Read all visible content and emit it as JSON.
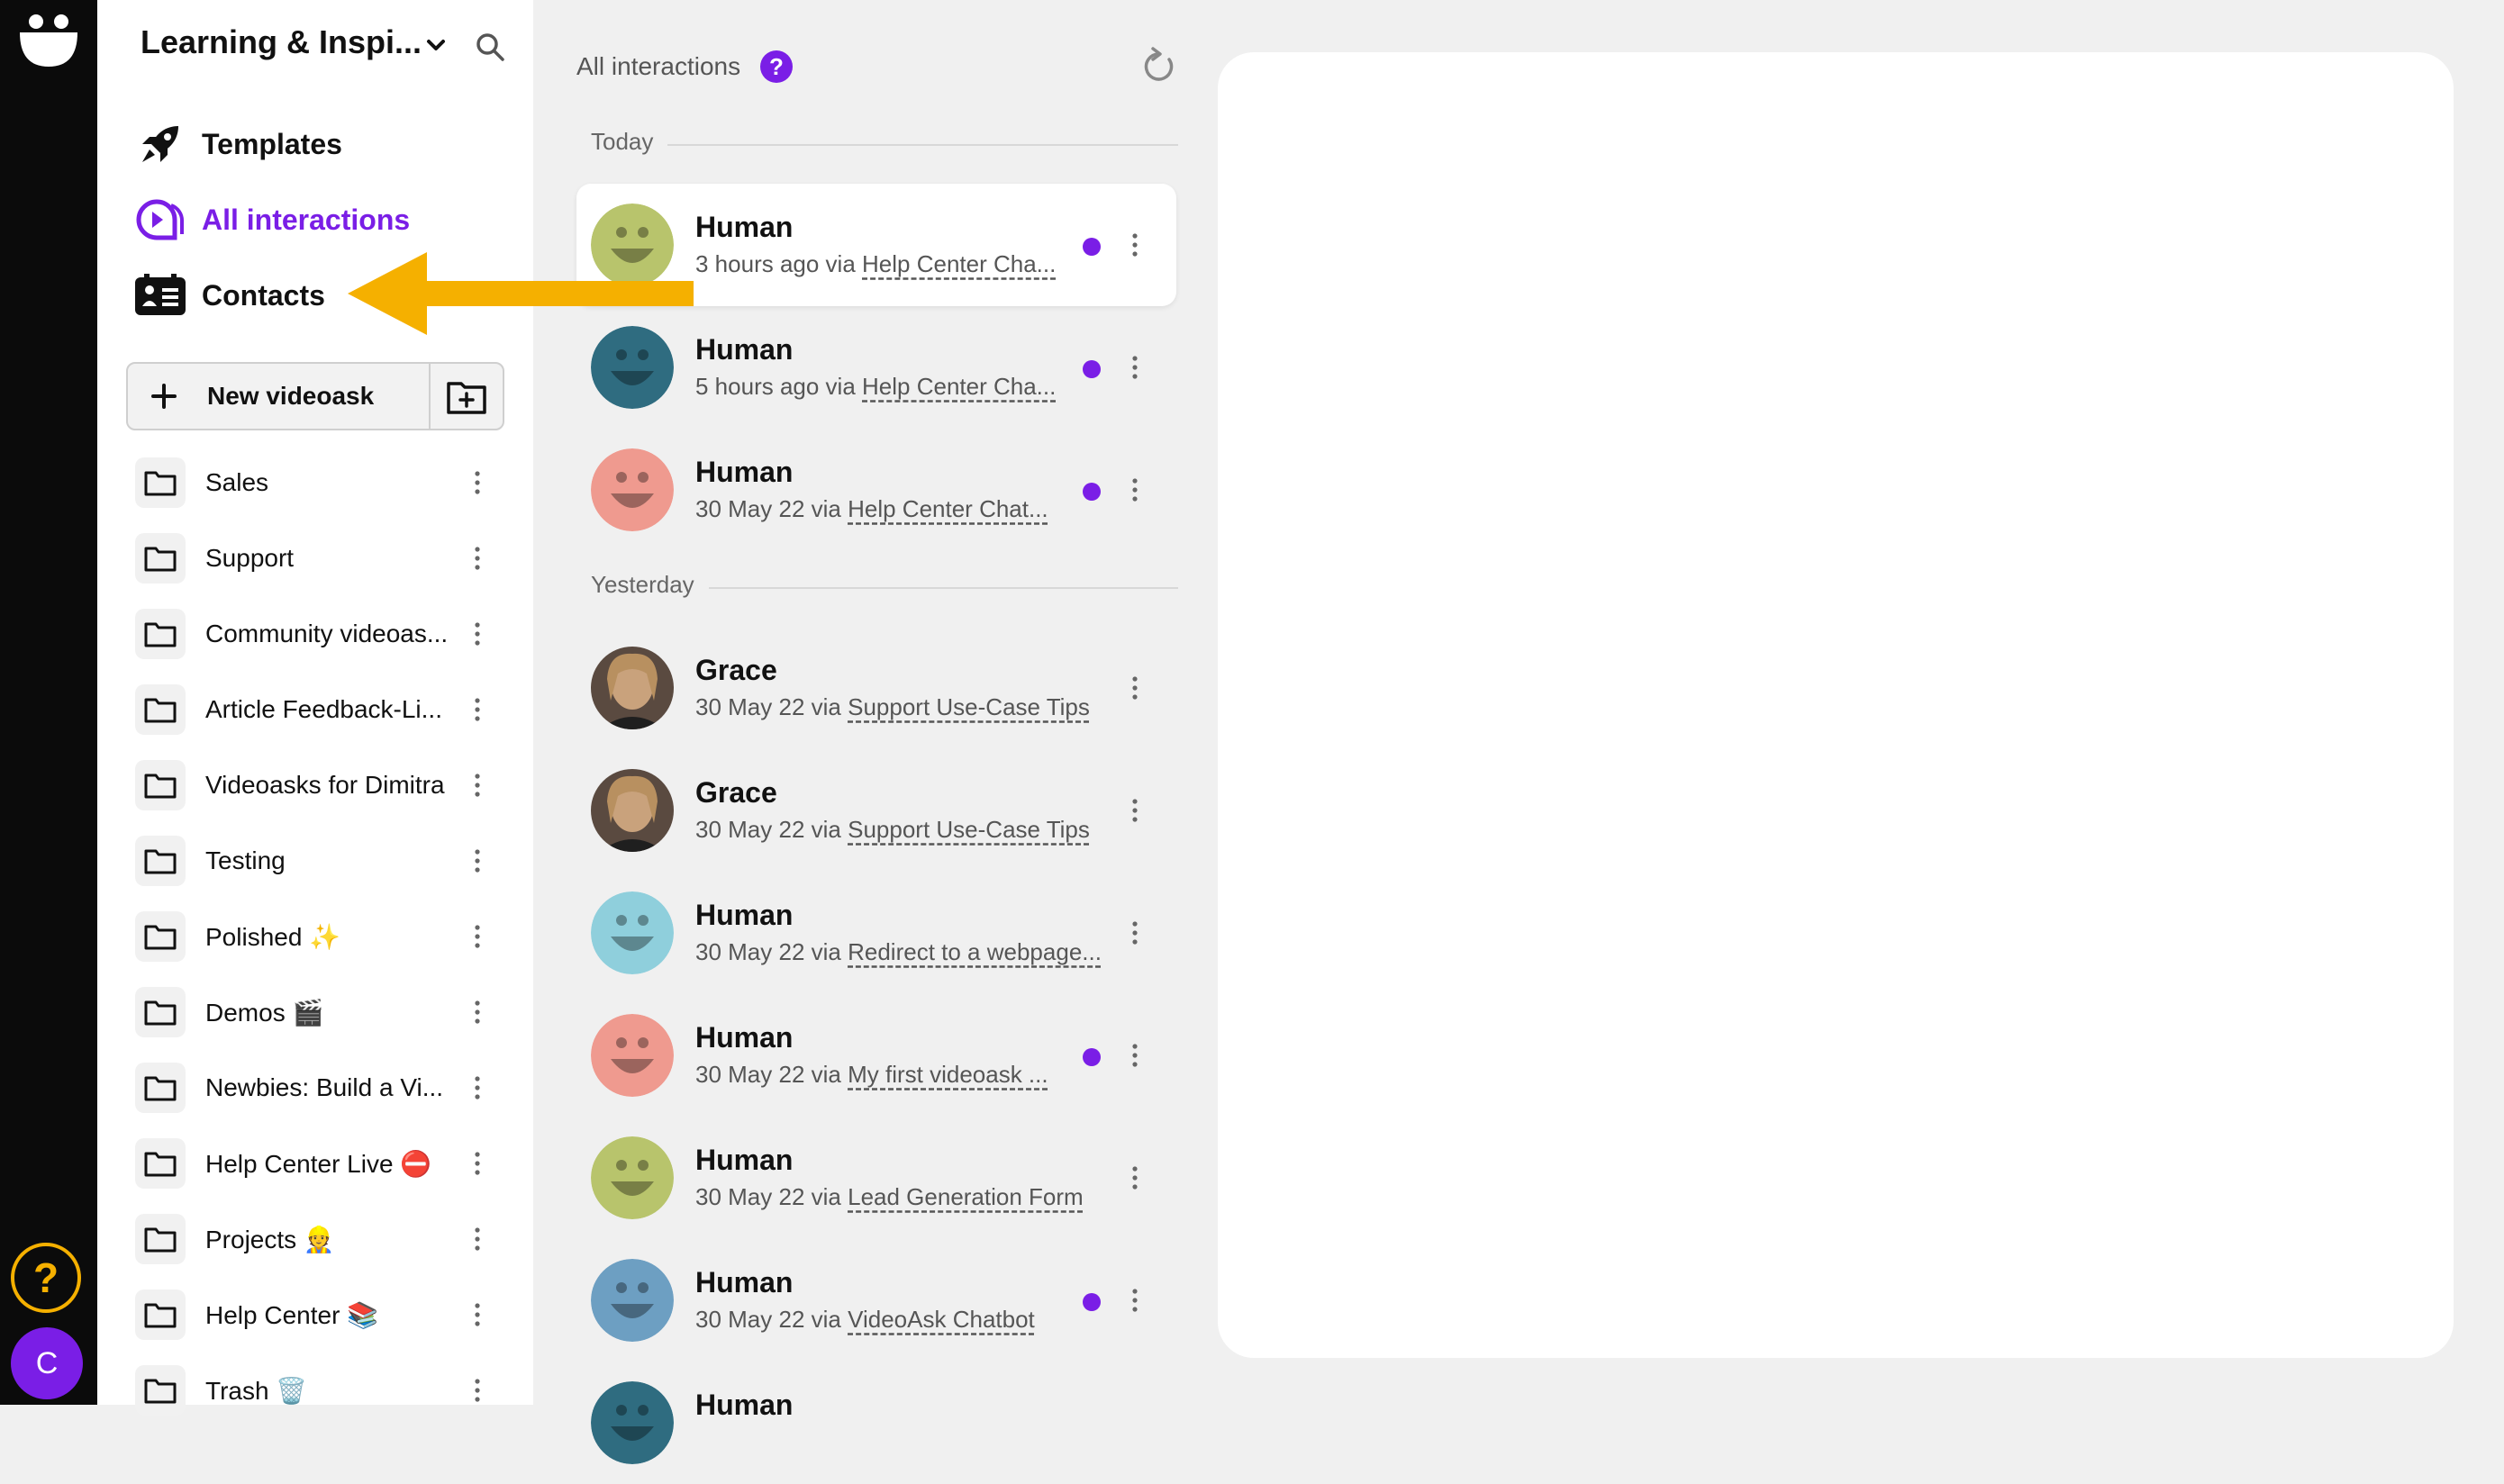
{
  "sidebar": {
    "workspace_title": "Learning & Inspi...",
    "nav": [
      {
        "label": "Templates",
        "icon": "rocket-icon"
      },
      {
        "label": "All interactions",
        "icon": "chat-play-icon",
        "active": true
      },
      {
        "label": "Contacts",
        "icon": "contacts-card-icon"
      }
    ],
    "new_button_label": "New videoask",
    "folders": [
      {
        "name": "Sales"
      },
      {
        "name": "Support"
      },
      {
        "name": "Community videoas..."
      },
      {
        "name": "Article Feedback-Li..."
      },
      {
        "name": "Videoasks for Dimitra"
      },
      {
        "name": "Testing"
      },
      {
        "name": "Polished ✨"
      },
      {
        "name": "Demos 🎬"
      },
      {
        "name": "Newbies: Build a Vi..."
      },
      {
        "name": "Help Center Live ⛔"
      },
      {
        "name": "Projects 👷"
      },
      {
        "name": "Help Center 📚"
      },
      {
        "name": "Trash 🗑️"
      }
    ]
  },
  "rail": {
    "help_label": "?",
    "avatar_initial": "C"
  },
  "list": {
    "header": "All interactions",
    "help_badge": "?",
    "sections": {
      "today": "Today",
      "yesterday": "Yesterday"
    },
    "rows": [
      {
        "name": "Human",
        "time": "3 hours ago via",
        "source": "Help Center Cha...",
        "unread": true,
        "avatar_color": "#b8c46c"
      },
      {
        "name": "Human",
        "time": "5 hours ago via",
        "source": "Help Center Cha...",
        "unread": true,
        "avatar_color": "#2f6c80"
      },
      {
        "name": "Human",
        "time": "30 May 22 via",
        "source": "Help Center Chat...",
        "unread": true,
        "avatar_color": "#ef9a8f"
      },
      {
        "name": "Grace",
        "time": "30 May 22 via",
        "source": "Support Use-Case Tips",
        "unread": false,
        "avatar_color": "photo"
      },
      {
        "name": "Grace",
        "time": "30 May 22 via",
        "source": "Support Use-Case Tips",
        "unread": false,
        "avatar_color": "photo"
      },
      {
        "name": "Human",
        "time": "30 May 22 via",
        "source": "Redirect to a webpage...",
        "unread": false,
        "avatar_color": "#8fcfdc"
      },
      {
        "name": "Human",
        "time": "30 May 22 via",
        "source": "My first videoask ...",
        "unread": true,
        "avatar_color": "#ef9a8f"
      },
      {
        "name": "Human",
        "time": "30 May 22 via",
        "source": "Lead Generation Form",
        "unread": false,
        "avatar_color": "#b8c46c"
      },
      {
        "name": "Human",
        "time": "30 May 22 via",
        "source": "VideoAsk Chatbot",
        "unread": true,
        "avatar_color": "#6d9fc2"
      },
      {
        "name": "Human",
        "time": "",
        "source": "",
        "unread": false,
        "avatar_color": "#2f6c80"
      }
    ]
  },
  "colors": {
    "accent": "#7a1ee6",
    "arrow": "#f5b000"
  }
}
